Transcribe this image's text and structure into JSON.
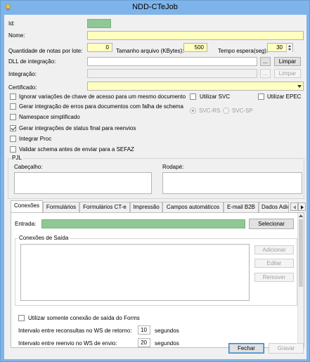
{
  "window": {
    "title": "NDD-CTeJob"
  },
  "form": {
    "id_label": "Id:",
    "nome_label": "Nome:",
    "qtd_label": "Quantidade de notas por lote:",
    "qtd_value": "0",
    "tam_label": "Tamanho arquivo (KBytes):",
    "tam_value": "500",
    "tempo_label": "Tempo espera(seg):",
    "tempo_value": "30",
    "dll_label": "DLL de integração:",
    "dll_browse": "...",
    "dll_clear": "Limpar",
    "integracao_label": "Integração:",
    "integracao_browse": "...",
    "integracao_clear": "Limpar",
    "certificado_label": "Certificado:"
  },
  "options": {
    "items": [
      {
        "label": "Ignorar variações de chave de acesso para um mesmo documento",
        "checked": false
      },
      {
        "label": "Gerar integração de erros para documentos com falha de schema",
        "checked": false
      },
      {
        "label": "Namespace simplificado",
        "checked": false
      },
      {
        "label": "Gerar integrações de status final para reenvios",
        "checked": true
      },
      {
        "label": "Integrar Proc",
        "checked": false
      },
      {
        "label": "Validar schema antes de enviar para a SEFAZ",
        "checked": false
      }
    ],
    "utilizar_svc": "Utilizar SVC",
    "utilizar_epec": "Utilizar EPEC",
    "svc_rs": "SVC-RS",
    "svc_sp": "SVC-SP"
  },
  "pjl": {
    "group_label": "PJL",
    "cabecalho_label": "Cabeçalho:",
    "rodape_label": "Rodapé:"
  },
  "tabs": [
    "Conexões",
    "Formulários",
    "Formulários CT-e",
    "Impressão",
    "Campos automáticos",
    "E-mail B2B",
    "Dados Adic"
  ],
  "conexoes": {
    "entrada_label": "Entrada:",
    "selecionar": "Selecionar",
    "saida_group": "Conexões de Saída",
    "adicionar": "Adicionar",
    "editar": "Editar",
    "remover": "Remover",
    "somente_forms": "Utilizar somente conexão de saída do Forms",
    "intervalo_retorno_label": "Intervalo entre reconsultas no WS de retorno:",
    "intervalo_retorno_value": "10",
    "intervalo_envio_label": "Intervalo entre reenvio no WS de envio:",
    "intervalo_envio_value": "20",
    "segundos1": "segundos",
    "segundos2": "segundos"
  },
  "footer": {
    "fechar": "Fechar",
    "gravar": "Gravar"
  },
  "colors": {
    "accent_green": "#8fc795",
    "title_blue": "#7eb4ea",
    "required_yellow": "#ffffc0"
  }
}
